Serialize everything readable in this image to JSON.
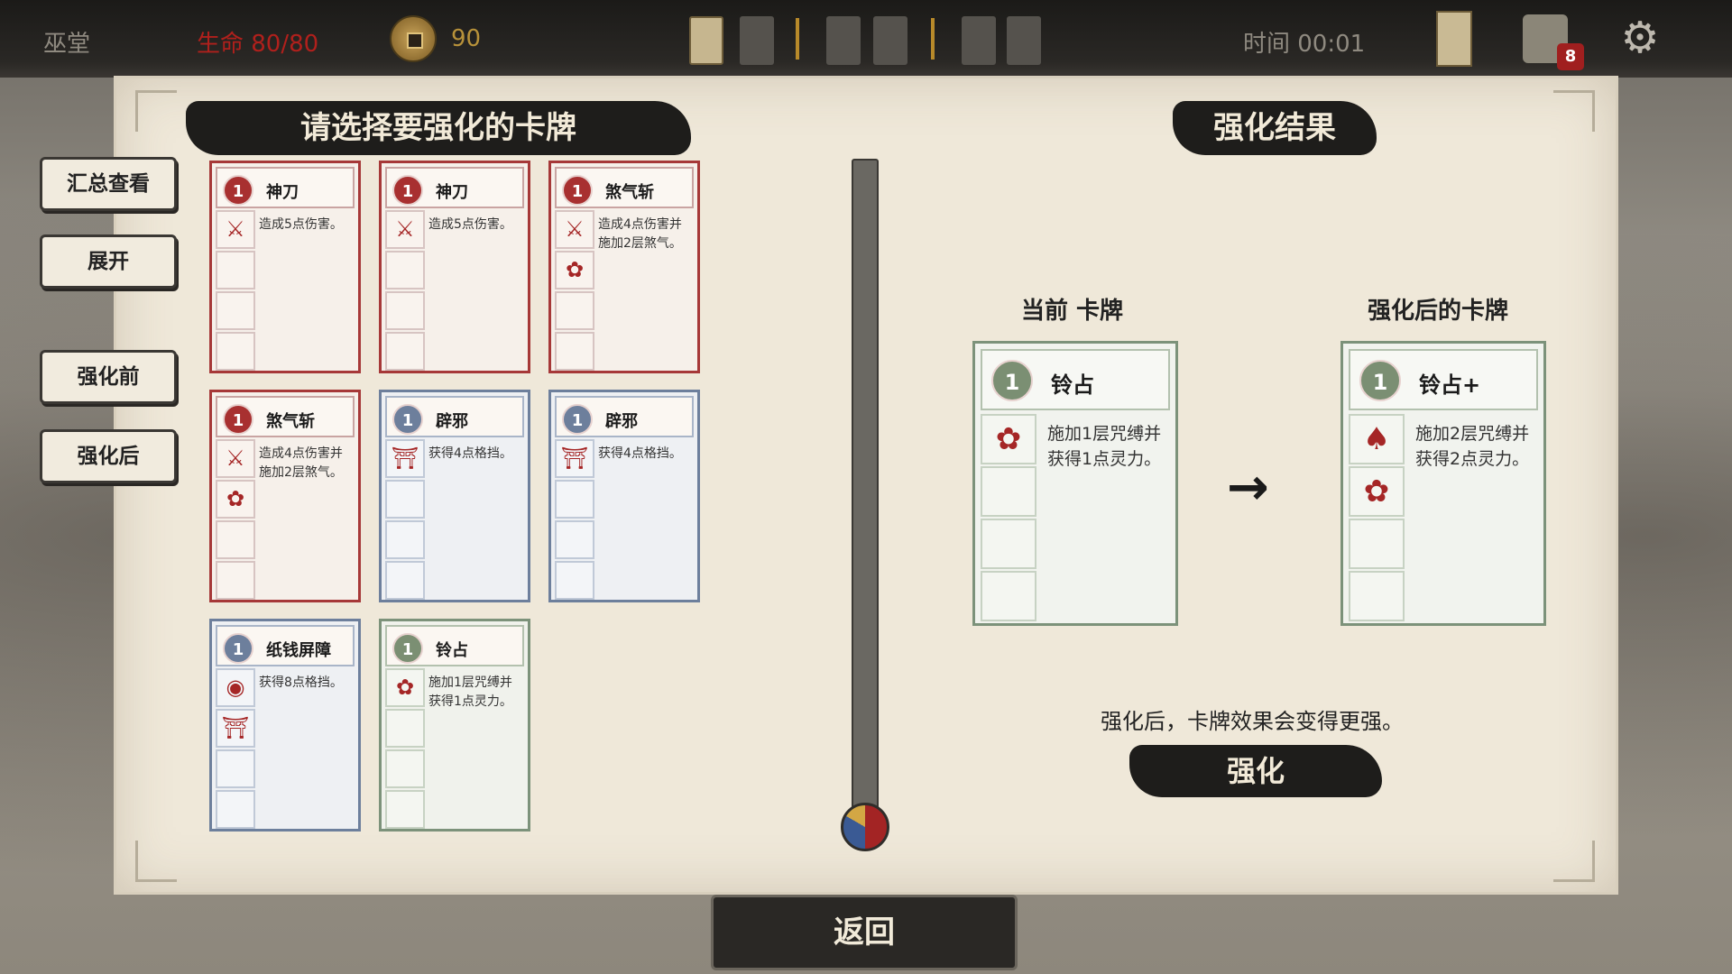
{
  "topbar": {
    "location": "巫堂",
    "hp": "生命 80/80",
    "coins": "90",
    "timer": "时间 00:01",
    "deck_count": "8"
  },
  "icons": {
    "coin": "coin-icon",
    "map": "map-scroll-icon",
    "bag": "card-bag-icon",
    "settings": "gear-icon"
  },
  "left": {
    "title": "请选择要强化的卡牌",
    "summary": "汇总查看",
    "expand": "展开",
    "before": "强化前",
    "after": "强化后"
  },
  "cards": [
    {
      "cost": "1",
      "name": "神刀",
      "desc": "造成5点伤害。",
      "color": "red",
      "icons": [
        "blade-icon"
      ]
    },
    {
      "cost": "1",
      "name": "神刀",
      "desc": "造成5点伤害。",
      "color": "red",
      "icons": [
        "blade-icon"
      ]
    },
    {
      "cost": "1",
      "name": "煞气斩",
      "desc": "造成4点伤害并施加2层煞气。",
      "color": "red",
      "icons": [
        "blade-icon",
        "tomoe-icon"
      ]
    },
    {
      "cost": "1",
      "name": "煞气斩",
      "desc": "造成4点伤害并施加2层煞气。",
      "color": "red",
      "icons": [
        "blade-icon",
        "tomoe-icon"
      ]
    },
    {
      "cost": "1",
      "name": "辟邪",
      "desc": "获得4点格挡。",
      "color": "blue",
      "icons": [
        "shrine-icon"
      ]
    },
    {
      "cost": "1",
      "name": "辟邪",
      "desc": "获得4点格挡。",
      "color": "blue",
      "icons": [
        "shrine-icon"
      ]
    },
    {
      "cost": "1",
      "name": "纸钱屏障",
      "desc": "获得8点格挡。",
      "color": "blue",
      "icons": [
        "coin-token-icon",
        "shrine-icon"
      ]
    },
    {
      "cost": "1",
      "name": "铃占",
      "desc": "施加1层咒缚并获得1点灵力。",
      "color": "green",
      "icons": [
        "tomoe-icon"
      ]
    }
  ],
  "right": {
    "title": "强化结果",
    "current_label": "当前 卡牌",
    "upgraded_label": "强化后的卡牌",
    "current": {
      "cost": "1",
      "name": "铃占",
      "desc": "施加1层咒缚并获得1点灵力。"
    },
    "upgraded": {
      "cost": "1",
      "name": "铃占+",
      "desc": "施加2层咒缚并获得2点灵力。"
    },
    "arrow": "→",
    "note": "强化后，卡牌效果会变得更强。",
    "upgrade_button": "强化"
  },
  "return_button": "返回",
  "colors": {
    "red": "#a63838",
    "blue": "#6d7f9c",
    "green": "#7c927a"
  }
}
